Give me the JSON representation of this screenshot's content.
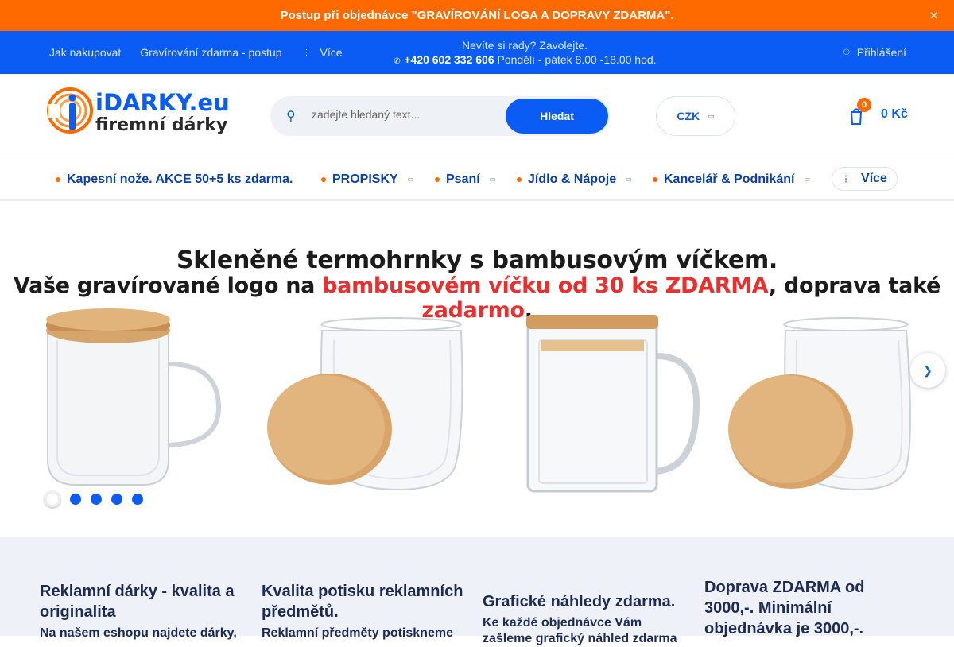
{
  "promo": {
    "text": "Postup při objednávce \"GRAVÍROVÁNÍ LOGA A DOPRAVY ZDARMA\"."
  },
  "topbar": {
    "links": [
      "Jak nakupovat",
      "Gravírování zdarma - postup"
    ],
    "more_label": "Více",
    "contact_line1": "Nevíte si rady? Zavolejte.",
    "phone": "+420 602 332 606",
    "hours": "Pondělí - pátek 8.00 -18.00 hod.",
    "login": "Přihlášení"
  },
  "header": {
    "logo_top": "iDARKY.eu",
    "logo_bottom": "firemní dárky",
    "search_placeholder": "zadejte hledaný text...",
    "search_button": "Hledat",
    "currency": "CZK",
    "cart_count": "0",
    "cart_total": "0 Kč"
  },
  "categories": {
    "items": [
      "Kapesní nože. AKCE 50+5 ks zdarma.",
      "PROPISKY",
      "Psaní",
      "Jídlo & Nápoje",
      "Kancelář & Podnikání"
    ],
    "more": "Více"
  },
  "banner": {
    "headline": "Skleněné termohrnky s bambusovým víčkem.",
    "sub_a": "Vaše gravírované logo na ",
    "sub_b": "bambusovém víčku od 30 ks ZDARMA",
    "sub_c": ", doprava také ",
    "sub_d": "zadarmo",
    "sub_e": "."
  },
  "features": [
    {
      "title": "Reklamní dárky - kvalita a originalita",
      "desc": "Na našem eshopu najdete dárky,"
    },
    {
      "title": "Kvalita potisku reklamních předmětů.",
      "desc": "Reklamní předměty potiskneme"
    },
    {
      "title": "Grafické náhledy zdarma.",
      "desc": "Ke každé objednávce Vám zašleme grafický náhled zdarma"
    },
    {
      "title": "Doprava ZDARMA od 3000,-. Minimální objednávka je 3000,-.",
      "desc": ""
    }
  ],
  "colors": {
    "brand_blue": "#0a5cf5",
    "accent_orange": "#ff6a00",
    "promo_red": "#e8302f"
  },
  "icons": {
    "close": "close-icon",
    "search": "search-icon",
    "cart": "cart-icon",
    "login": "user-icon",
    "phone": "phone-icon"
  }
}
